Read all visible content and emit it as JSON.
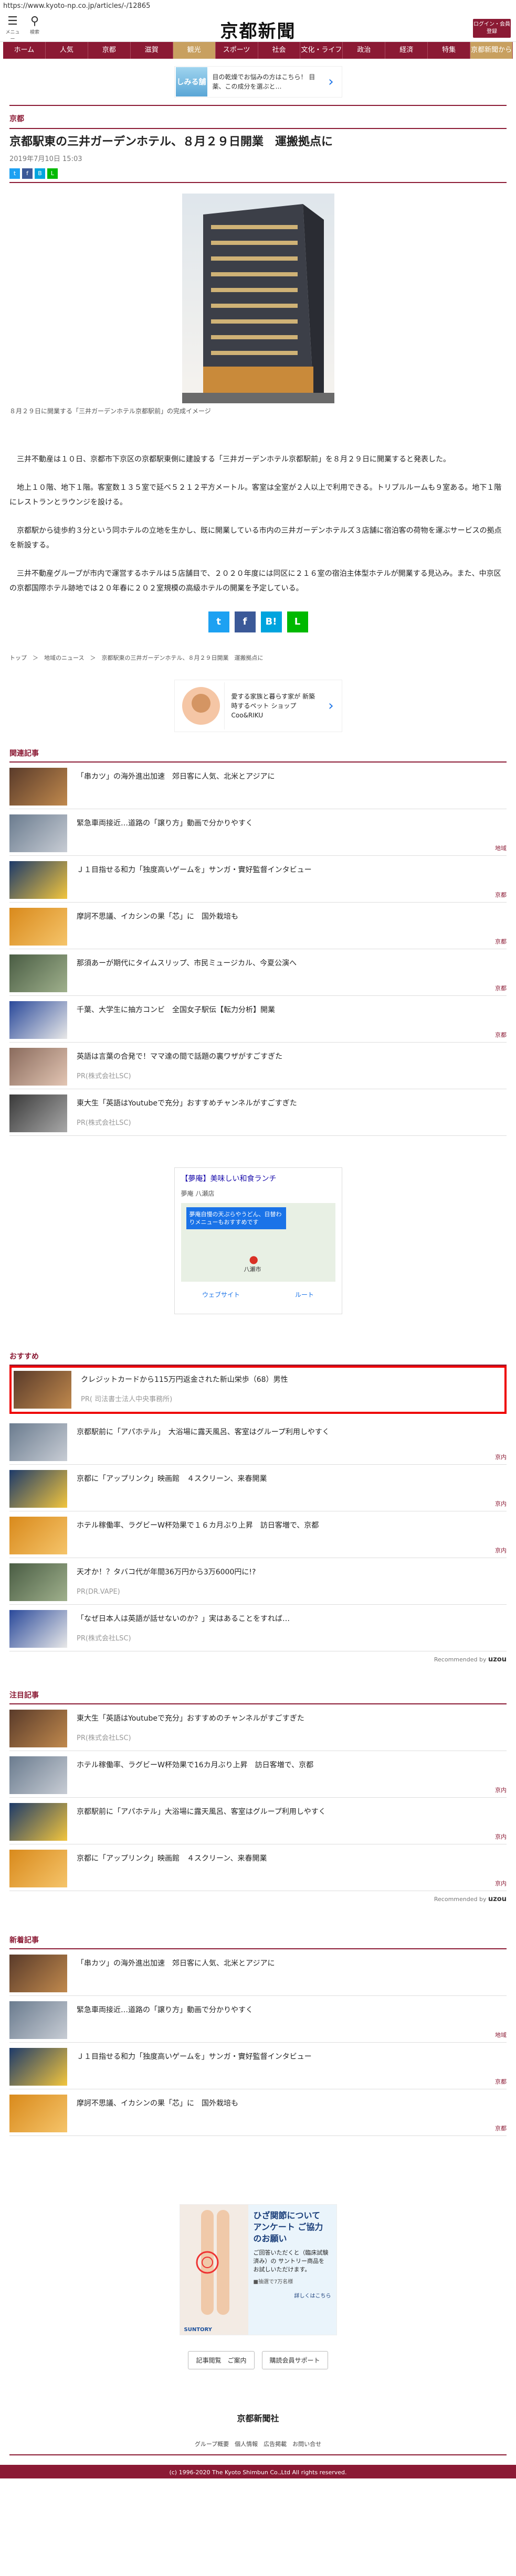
{
  "url": "https://www.kyoto-np.co.jp/articles/-/12865",
  "header": {
    "menu_label": "メニュー",
    "search_label": "検索",
    "logo_text": "京都新聞",
    "login_label": "ログイン・会員登録"
  },
  "nav": [
    "ホーム",
    "人気",
    "京都",
    "滋賀",
    "観光",
    "スポーツ",
    "社会",
    "文化・ライフ",
    "政治",
    "経済",
    "特集",
    "京都新聞から"
  ],
  "ad_top": {
    "brand": "しみる舗",
    "text": "目の乾燥でお悩みの方はこちら！ 目薬、この成分を選ぶと…",
    "arrow": "›"
  },
  "article": {
    "category": "京都",
    "title": "京都駅東の三井ガーデンホテル、８月２９日開業　運搬拠点に",
    "date": "2019年7月10日 15:03",
    "caption": "８月２９日に開業する「三井ガーデンホテル京都駅前」の完成イメージ",
    "paragraphs": [
      "　三井不動産は１０日、京都市下京区の京都駅東側に建設する「三井ガーデンホテル京都駅前」を８月２９日に開業すると発表した。",
      "　地上１０階、地下１階。客室数１３５室で延べ５２１２平方メートル。客室は全室が２人以上で利用できる。トリプルルームも９室ある。地下１階にレストランとラウンジを設ける。",
      "　京都駅から徒歩約３分という同ホテルの立地を生かし、既に開業している市内の三井ガーデンホテルズ３店舗に宿泊客の荷物を運ぶサービスの拠点を新設する。",
      "　三井不動産グループが市内で運営するホテルは５店舗目で、２０２０年度には同区に２１６室の宿泊主体型ホテルが開業する見込み。また、中京区の京都国際ホテル跡地では２０年春に２０２室規模の高級ホテルの開業を予定している。"
    ],
    "share_big": [
      "t",
      "f",
      "B!",
      "L"
    ],
    "breadcrumb": "トップ　＞　地域のニュース　＞　京都駅東の三井ガーデンホテル、８月２９日開業　運搬拠点に"
  },
  "ad_mid": {
    "text": "愛する家族と暮らす家が 新築時するペット ショップCoo&RIKU",
    "arrow": "›"
  },
  "related": {
    "title": "関連記事",
    "items": [
      {
        "text": "「串カツ」の海外進出加速　郊日客に人気、北米とアジアに",
        "tag": ""
      },
      {
        "text": "緊急車両接近…道路の「譲り方」動画で分かりやすく",
        "tag": "地域"
      },
      {
        "text": "Ｊ１目指せる和力「独度高いゲームを」サンガ・實好監督インタビュー",
        "tag": "京都"
      },
      {
        "text": "摩訶不思議、イカシンの果「芯」に　国外栽培も",
        "tag": "京都"
      },
      {
        "text": "那須あーが期代にタイムスリップ、市民ミュージカル、今夏公演へ",
        "tag": "京都"
      },
      {
        "text": "千葉、大学生に抽方コンビ　全国女子駅伝【転力分析】開業",
        "tag": "京都"
      },
      {
        "text": "英語は言葉の合発で！ママ達の間で話題の裏ワザがすごすぎた",
        "pr": "PR(株式会社LSC)"
      },
      {
        "text": "東大生「英語はYoutubeで充分」おすすめチャンネルがすごすぎた",
        "pr": "PR(株式会社LSC)"
      }
    ]
  },
  "map_ad": {
    "title": "【夢庵】美味しい和食ランチ",
    "sub": "夢庵 八瀬店",
    "bubble": "夢庵自慢の天ぷらやうどん、日替わりメニューもおすすめです",
    "place": "八瀬市",
    "website": "ウェブサイト",
    "route": "ルート"
  },
  "recommend": {
    "title": "おすすめ",
    "items": [
      {
        "text": "クレジットカードから115万円返金された新山栄歩（68）男性",
        "pr": "PR( 司法書士法人中央事務所)",
        "highlight": true
      },
      {
        "text": "京都駅前に「アパホテル」　大浴場に露天風呂、客室はグループ利用しやすく",
        "tag": "京内"
      },
      {
        "text": "京都に「アップリンク」映画館　４スクリーン、来春開業",
        "tag": "京内"
      },
      {
        "text": "ホテル稼働率、ラグビーW杯効果で１６カ月ぶり上昇　訪日客増で、京都",
        "tag": "京内"
      },
      {
        "text": "天才か！？タバコ代が年間36万円から3万6000円に!?",
        "pr": "PR(DR.VAPE)"
      },
      {
        "text": "「なぜ日本人は英語が話せないのか？」実はあることをすれば…",
        "pr": "PR(株式会社LSC)"
      }
    ],
    "powered": "Recommended by",
    "brand": "uzou"
  },
  "attention": {
    "title": "注目記事",
    "items": [
      {
        "text": "東大生「英語はYoutubeで充分」おすすめのチャンネルがすごすぎた",
        "pr": "PR(株式会社LSC)"
      },
      {
        "text": "ホテル稼働率、ラグビーW杯効果で16カ月ぶり上昇　訪日客増で、京都",
        "tag": "京内"
      },
      {
        "text": "京都駅前に「アパホテル」大浴場に露天風呂、客室はグループ利用しやすく",
        "tag": "京内"
      },
      {
        "text": "京都に「アップリンク」映画館　４スクリーン、来春開業",
        "tag": "京内"
      }
    ],
    "powered": "Recommended by",
    "brand": "uzou"
  },
  "latest": {
    "title": "新着記事",
    "items": [
      {
        "text": "「串カツ」の海外進出加速　郊日客に人気、北米とアジアに",
        "tag": ""
      },
      {
        "text": "緊急車両接近…道路の「譲り方」動画で分かりやすく",
        "tag": "地域"
      },
      {
        "text": "Ｊ１目指せる和力「独度高いゲームを」サンガ・實好監督インタビュー",
        "tag": "京都"
      },
      {
        "text": "摩訶不思議、イカシンの果「芯」に　国外栽培も",
        "tag": "京都"
      }
    ]
  },
  "ad_knee": {
    "headline": "ひざ関節について アンケート ご協力のお願い",
    "body": "ご回答いただくと（臨床試験済み）の サントリー商品を お試しいただけます。",
    "note": "■抽選で7万名様",
    "brand": "SUNTORY",
    "link": "詳しくはこちら"
  },
  "footer": {
    "buttons": [
      "記事閲覧　ご案内",
      "購読会員サポート"
    ],
    "logo": "京都新聞社",
    "links": "グループ概要　個人情報　広告掲載　お問い合せ",
    "copyright": "(c) 1996-2020 The Kyoto Shimbun Co.,Ltd All rights reserved."
  }
}
